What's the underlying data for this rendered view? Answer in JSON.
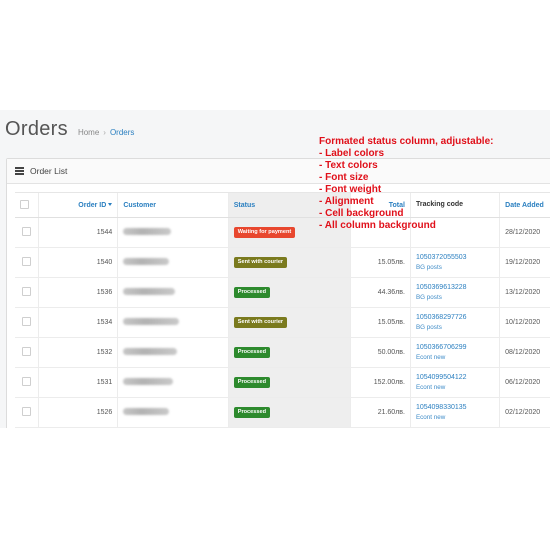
{
  "header": {
    "title": "Orders",
    "breadcrumb": [
      "Home",
      "Orders"
    ]
  },
  "panel": {
    "title": "Order List"
  },
  "table": {
    "columns": {
      "order_id": "Order ID",
      "customer": "Customer",
      "status": "Status",
      "total": "Total",
      "tracking": "Tracking code",
      "date_added": "Date Added"
    },
    "rows": [
      {
        "id": "1544",
        "status": "Waiting for payment",
        "status_color": "#e8472e",
        "total": "",
        "tracking": "",
        "courier": "",
        "date": "28/12/2020"
      },
      {
        "id": "1540",
        "status": "Sent with courier",
        "status_color": "#7a7a1e",
        "total": "15.05лв.",
        "tracking": "1050372055503",
        "courier": "BG posts",
        "date": "19/12/2020"
      },
      {
        "id": "1536",
        "status": "Processed",
        "status_color": "#2d8a2d",
        "total": "44.36лв.",
        "tracking": "1050369613228",
        "courier": "BG posts",
        "date": "13/12/2020"
      },
      {
        "id": "1534",
        "status": "Sent with courier",
        "status_color": "#7a7a1e",
        "total": "15.05лв.",
        "tracking": "1050368297726",
        "courier": "BG posts",
        "date": "10/12/2020"
      },
      {
        "id": "1532",
        "status": "Processed",
        "status_color": "#2d8a2d",
        "total": "50.00лв.",
        "tracking": "1050366706299",
        "courier": "Econt new",
        "date": "08/12/2020"
      },
      {
        "id": "1531",
        "status": "Processed",
        "status_color": "#2d8a2d",
        "total": "152.00лв.",
        "tracking": "1054099504122",
        "courier": "Econt new",
        "date": "06/12/2020"
      },
      {
        "id": "1526",
        "status": "Processed",
        "status_color": "#2d8a2d",
        "total": "21.60лв.",
        "tracking": "1054098330135",
        "courier": "Econt new",
        "date": "02/12/2020"
      }
    ]
  },
  "annotation": {
    "title": "Formated status column, adjustable:",
    "items": [
      "- Label colors",
      "- Text colors",
      "- Font size",
      "- Font weight",
      "- Alignment",
      "- Cell background",
      "- All column background"
    ]
  },
  "colors": {
    "link": "#2a7fc0",
    "annotation": "#e0101a",
    "waiting": "#e8472e",
    "sent": "#7a7a1e",
    "processed": "#2d8a2d"
  }
}
